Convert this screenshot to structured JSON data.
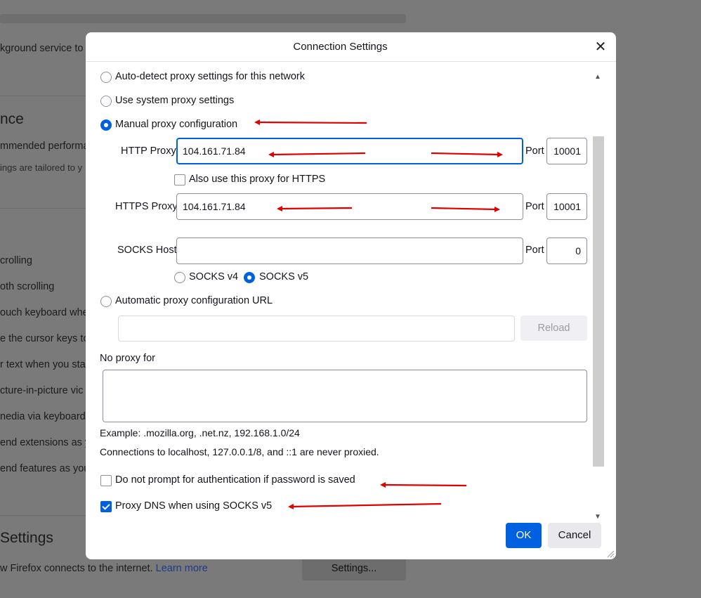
{
  "background": {
    "line1": "kground service to",
    "heading1": "nce",
    "line2": "mmended performa",
    "line3": "ings are tailored to y",
    "items": [
      "crolling",
      "oth scrolling",
      "ouch keyboard whe",
      "e the cursor keys to",
      "r text when you sta",
      "cture-in-picture vic",
      "nedia via keyboard",
      "end extensions as y",
      "end features as you"
    ],
    "heading2": "Settings",
    "footer_text": "w Firefox connects to the internet.",
    "learn_more": "Learn more",
    "settings_button": "Settings..."
  },
  "dialog": {
    "title": "Connection Settings",
    "close_glyph": "✕",
    "options": {
      "auto_detect": "Auto-detect proxy settings for this network",
      "system": "Use system proxy settings",
      "manual": "Manual proxy configuration",
      "auto_url": "Automatic proxy configuration URL"
    },
    "http_label": "HTTP Proxy",
    "http_value": "104.161.71.84",
    "http_port_label": "Port",
    "http_port": "10001",
    "also_https": "Also use this proxy for HTTPS",
    "https_label": "HTTPS Proxy",
    "https_value": "104.161.71.84",
    "https_port_label": "Port",
    "https_port": "10001",
    "socks_label": "SOCKS Host",
    "socks_value": "",
    "socks_port_label": "Port",
    "socks_port": "0",
    "socks_v4": "SOCKS v4",
    "socks_v5": "SOCKS v5",
    "auto_url_value": "",
    "reload": "Reload",
    "no_proxy_label": "No proxy for",
    "no_proxy_value": "",
    "example": "Example: .mozilla.org, .net.nz, 192.168.1.0/24",
    "localhost_note": "Connections to localhost, 127.0.0.1/8, and ::1 are never proxied.",
    "no_prompt_auth": "Do not prompt for authentication if password is saved",
    "proxy_dns": "Proxy DNS when using SOCKS v5",
    "ok": "OK",
    "cancel": "Cancel",
    "selected_option": "manual",
    "selected_socks": "v5",
    "also_https_checked": false,
    "no_prompt_checked": false,
    "proxy_dns_checked": true
  },
  "colors": {
    "accent": "#0061e0",
    "annotation": "#e00000"
  }
}
